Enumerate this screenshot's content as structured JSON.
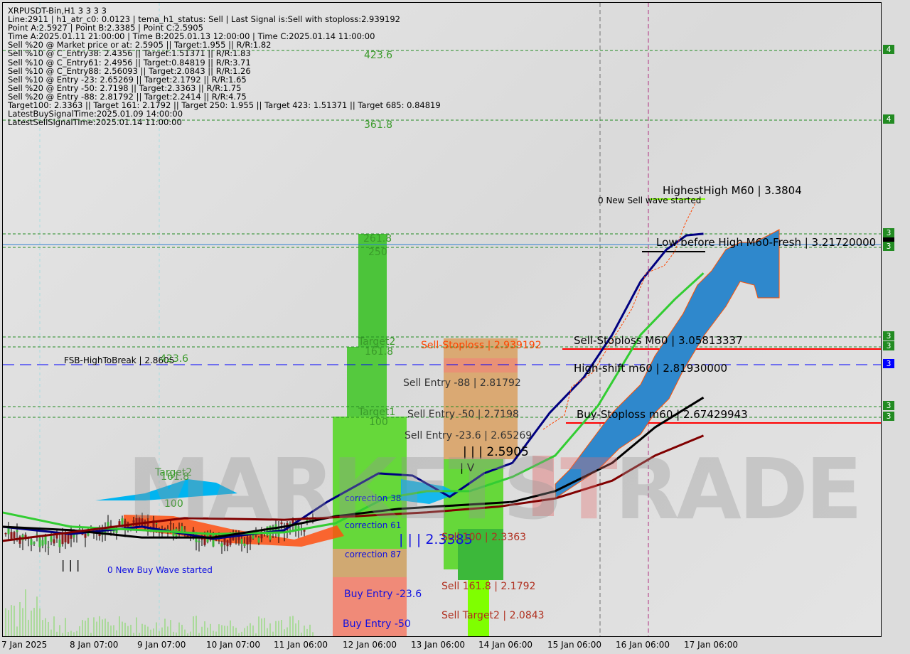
{
  "info_panel": {
    "lines": [
      "XRPUSDT-Bin,H1  3 3 3 3",
      "Line:2911 | h1_atr_c0: 0.0123 | tema_h1_status: Sell | Last Signal is:Sell with stoploss:2.939192",
      "Point A:2.5927 | Point B:2.3385 | Point C:2.5905",
      "Time A:2025.01.11 21:00:00 | Time B:2025.01.13 12:00:00 | Time C:2025.01.14 11:00:00",
      "Sell %20 @ Market price or at: 2.5905 || Target:1.955 || R/R:1.82",
      "Sell %10 @ C_Entry38: 2.4356 || Target:1.51371 || R/R:1.83",
      "Sell %10 @ C_Entry61: 2.4956 || Target:0.84819 || R/R:3.71",
      "Sell %10 @ C_Entry88: 2.56093 || Target:2.0843 || R/R:1.26",
      "Sell %10 @ Entry -23: 2.65269 || Target:2.1792 || R/R:1.65",
      "Sell %20 @ Entry -50: 2.7198 || Target:2.3363 || R/R:1.75",
      "Sell %20 @ Entry -88: 2.81792 || Target:2.2414 || R/R:4.75",
      "Target100: 2.3363 || Target 161: 2.1792 || Target 250: 1.955 || Target 423: 1.51371 || Target 685: 0.84819",
      "LatestBuySignalTime:2025.01.09 14:00:00",
      "LatestSellSignalTime:2025.01.14 11:00:00"
    ]
  },
  "watermark": "MARKETSTRADE",
  "colors": {
    "fast_ma": "#000080",
    "mid_ma": "#32cd32",
    "slow_ma": "#000000",
    "long_ma": "#800000",
    "cloud": "#1e90ff",
    "stoploss": "#ff0000",
    "level": "#228b22",
    "fsb": "#0000ff"
  },
  "chart_data": {
    "type": "candlestick",
    "symbol": "XRPUSDT-Bin",
    "timeframe": "H1",
    "x_tick_labels": [
      "7 Jan 2025",
      "8 Jan 07:00",
      "9 Jan 07:00",
      "10 Jan 07:00",
      "11 Jan 06:00",
      "12 Jan 06:00",
      "13 Jan 06:00",
      "14 Jan 06:00",
      "15 Jan 06:00",
      "16 Jan 06:00",
      "17 Jan 06:00"
    ],
    "y_axis_labels": [
      "4",
      "4",
      "3",
      "3",
      "3",
      "3",
      "3",
      "3",
      "3",
      "3"
    ],
    "grid": false,
    "series": [
      {
        "id": "fast_ma",
        "points": [
          [
            "2025-01-07T07:00",
            2.368
          ],
          [
            "2025-01-08T07:00",
            2.345
          ],
          [
            "2025-01-09T08:00",
            2.368
          ],
          [
            "2025-01-10T09:00",
            2.33
          ],
          [
            "2025-01-11T10:00",
            2.357
          ],
          [
            "2025-01-12T01:00",
            2.446
          ],
          [
            "2025-01-12T19:00",
            2.536
          ],
          [
            "2025-01-13T07:00",
            2.529
          ],
          [
            "2025-01-13T20:00",
            2.462
          ],
          [
            "2025-01-14T08:00",
            2.536
          ],
          [
            "2025-01-14T18:00",
            2.569
          ],
          [
            "2025-01-15T07:00",
            2.726
          ],
          [
            "2025-01-15T19:00",
            2.838
          ],
          [
            "2025-01-16T05:00",
            2.973
          ],
          [
            "2025-01-16T15:00",
            3.141
          ],
          [
            "2025-01-17T00:00",
            3.241
          ],
          [
            "2025-01-17T07:00",
            3.286
          ],
          [
            "2025-01-17T13:00",
            3.291
          ]
        ]
      },
      {
        "id": "mid_ma",
        "points": [
          [
            "2025-01-07T07:00",
            2.413
          ],
          [
            "2025-01-08T07:00",
            2.368
          ],
          [
            "2025-01-09T08:00",
            2.357
          ],
          [
            "2025-01-10T09:00",
            2.345
          ],
          [
            "2025-01-11T10:00",
            2.35
          ],
          [
            "2025-01-12T04:00",
            2.379
          ],
          [
            "2025-01-12T21:00",
            2.457
          ],
          [
            "2025-01-13T12:00",
            2.48
          ],
          [
            "2025-01-14T03:00",
            2.48
          ],
          [
            "2025-01-14T18:00",
            2.525
          ],
          [
            "2025-01-15T09:00",
            2.592
          ],
          [
            "2025-01-16T00:00",
            2.749
          ],
          [
            "2025-01-16T15:00",
            2.973
          ],
          [
            "2025-01-17T03:00",
            3.085
          ],
          [
            "2025-01-17T13:00",
            3.167
          ]
        ]
      },
      {
        "id": "slow_ma",
        "points": [
          [
            "2025-01-07T07:00",
            2.368
          ],
          [
            "2025-01-08T07:00",
            2.357
          ],
          [
            "2025-01-09T08:00",
            2.334
          ],
          [
            "2025-01-10T09:00",
            2.334
          ],
          [
            "2025-01-11T10:00",
            2.368
          ],
          [
            "2025-01-12T04:00",
            2.401
          ],
          [
            "2025-01-13T02:00",
            2.424
          ],
          [
            "2025-01-13T22:00",
            2.435
          ],
          [
            "2025-01-14T18:00",
            2.446
          ],
          [
            "2025-01-15T09:00",
            2.48
          ],
          [
            "2025-01-16T05:00",
            2.569
          ],
          [
            "2025-01-16T20:00",
            2.681
          ],
          [
            "2025-01-17T13:00",
            2.775
          ]
        ]
      },
      {
        "id": "long_ma",
        "points": [
          [
            "2025-01-07T07:00",
            2.323
          ],
          [
            "2025-01-08T07:00",
            2.35
          ],
          [
            "2025-01-09T08:00",
            2.379
          ],
          [
            "2025-01-09T23:00",
            2.395
          ],
          [
            "2025-01-11T10:00",
            2.39
          ],
          [
            "2025-01-12T11:00",
            2.401
          ],
          [
            "2025-01-13T12:00",
            2.413
          ],
          [
            "2025-01-14T13:00",
            2.431
          ],
          [
            "2025-01-15T09:00",
            2.457
          ],
          [
            "2025-01-16T05:00",
            2.513
          ],
          [
            "2025-01-16T20:00",
            2.592
          ],
          [
            "2025-01-17T13:00",
            2.655
          ]
        ]
      }
    ],
    "annotations": {
      "fib_top": [
        "423.6",
        "361.8",
        "261.8",
        "250",
        "Target2",
        "161.8",
        "Target1",
        "100"
      ],
      "fib_left": [
        "Target2",
        "161.8",
        "100"
      ],
      "fsb": "FSB-HighToBreak | 2.8605",
      "fsb_fib": "423.6",
      "sell_stoploss": "Sell-Stoploss | 2.939192",
      "sell_entry_88": "Sell Entry -88 | 2.81792",
      "sell_entry_50": "Sell Entry -50 | 2.7198",
      "sell_entry_23": "Sell Entry -23.6 | 2.65269",
      "point_c": "| | | 2.5905",
      "wave_iv": "| V",
      "correction_38": "correction 38",
      "correction_61": "correction 61",
      "correction_87": "correction 87",
      "point_b": "| | | 2.3385",
      "sell_100": "Sell 100 | 2.3363",
      "sell_161": "Sell 161.8 | 2.1792",
      "sell_target2": "Sell Target2 | 2.0843",
      "buy_entry_23": "Buy Entry -23.6",
      "buy_entry_50": "Buy Entry -50",
      "wave_iii": "| | |",
      "new_buy_wave": "0 New Buy Wave started",
      "highest_high": "HighestHigh    M60 | 3.3804",
      "new_sell_wave": "0 New Sell wave started",
      "low_before_high": "Low before High   M60-Fresh | 3.21720000",
      "sell_stoploss_m60": "Sell-Stoploss M60 | 3.05813337",
      "high_shift_m60": "High-shift m60 | 2.81930000",
      "buy_stoploss_m60": "Buy-Stoploss m60 | 2.67429943"
    }
  }
}
